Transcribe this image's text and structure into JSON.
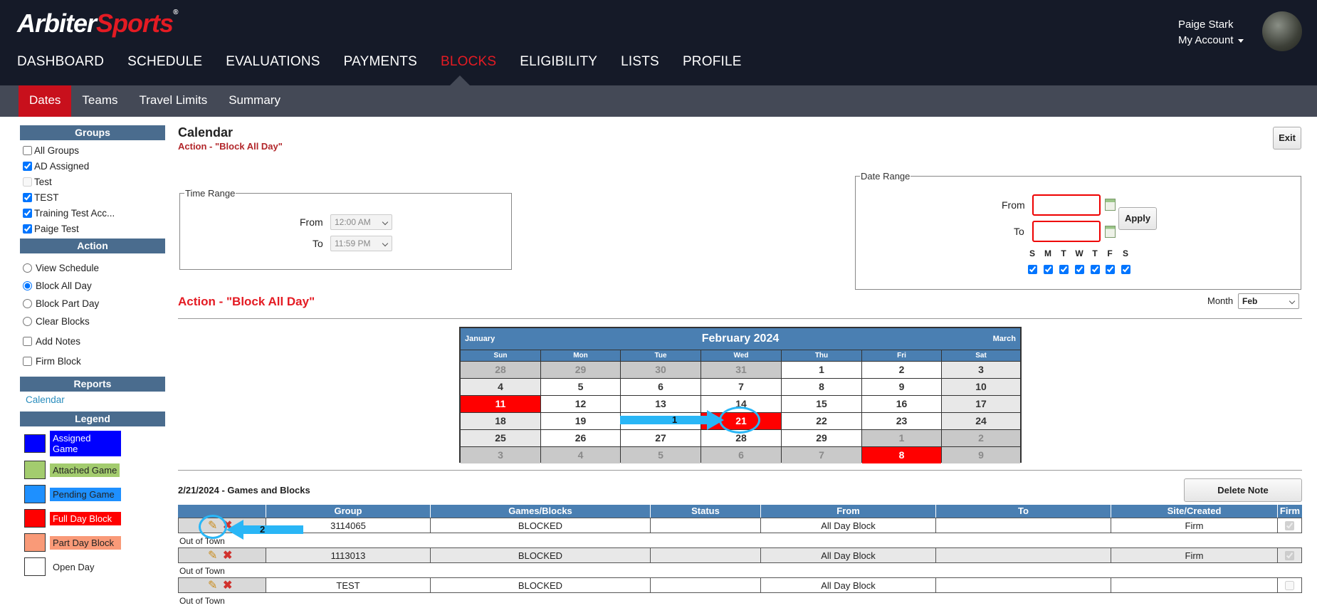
{
  "logo": {
    "part1": "Arbiter",
    "part2": "Sports",
    "reg": "®"
  },
  "main_nav": [
    {
      "label": "DASHBOARD"
    },
    {
      "label": "SCHEDULE"
    },
    {
      "label": "EVALUATIONS"
    },
    {
      "label": "PAYMENTS"
    },
    {
      "label": "BLOCKS"
    },
    {
      "label": "ELIGIBILITY"
    },
    {
      "label": "LISTS"
    },
    {
      "label": "PROFILE"
    }
  ],
  "user": {
    "name": "Paige Stark",
    "account": "My Account"
  },
  "sub_nav": [
    {
      "label": "Dates"
    },
    {
      "label": "Teams"
    },
    {
      "label": "Travel Limits"
    },
    {
      "label": "Summary"
    }
  ],
  "sidebar": {
    "groups_title": "Groups",
    "groups": [
      {
        "label": "All Groups",
        "checked": false
      },
      {
        "label": "AD Assigned",
        "checked": true
      },
      {
        "label": "Test",
        "checked": false
      },
      {
        "label": "TEST",
        "checked": true
      },
      {
        "label": "Training Test Acc...",
        "checked": true
      },
      {
        "label": "Paige Test",
        "checked": true
      }
    ],
    "action_title": "Action",
    "actions": [
      {
        "label": "View Schedule",
        "selected": false
      },
      {
        "label": "Block All Day",
        "selected": true
      },
      {
        "label": "Block Part Day",
        "selected": false
      },
      {
        "label": "Clear Blocks",
        "selected": false
      }
    ],
    "action_checks": [
      {
        "label": "Add Notes",
        "checked": false
      },
      {
        "label": "Firm Block",
        "checked": false
      }
    ],
    "reports_title": "Reports",
    "reports_link": "Calendar",
    "legend_title": "Legend",
    "legend": [
      {
        "label": "Assigned Game",
        "color": "#0000ff",
        "text_color": "#ffffff"
      },
      {
        "label": "Attached Game",
        "color": "#a3cc6e",
        "text_color": "#222222"
      },
      {
        "label": "Pending Game",
        "color": "#1e90ff",
        "text_color": "#222222"
      },
      {
        "label": "Full Day Block",
        "color": "#ff0000",
        "text_color": "#ffffff"
      },
      {
        "label": "Part Day Block",
        "color": "#f99a78",
        "text_color": "#222222"
      },
      {
        "label": "Open Day",
        "color": "#ffffff",
        "text_color": "#222222"
      }
    ]
  },
  "page": {
    "title": "Calendar",
    "subtitle": "Action - \"Block All Day\"",
    "exit_label": "Exit"
  },
  "time_range": {
    "legend": "Time Range",
    "from_label": "From",
    "from_value": "12:00 AM",
    "to_label": "To",
    "to_value": "11:59 PM"
  },
  "date_range": {
    "legend": "Date Range",
    "from_label": "From",
    "to_label": "To",
    "apply_label": "Apply",
    "days": [
      "S",
      "M",
      "T",
      "W",
      "T",
      "F",
      "S"
    ]
  },
  "action_label": "Action - \"Block All Day\"",
  "month_select": {
    "label": "Month",
    "value": "Feb"
  },
  "calendar": {
    "prev": "January",
    "title": "February 2024",
    "next": "March",
    "dow": [
      "Sun",
      "Mon",
      "Tue",
      "Wed",
      "Thu",
      "Fri",
      "Sat"
    ],
    "weeks": [
      [
        {
          "d": "28",
          "t": "o"
        },
        {
          "d": "29",
          "t": "o"
        },
        {
          "d": "30",
          "t": "o"
        },
        {
          "d": "31",
          "t": "o"
        },
        {
          "d": "1",
          "t": "w"
        },
        {
          "d": "2",
          "t": "w"
        },
        {
          "d": "3",
          "t": "e"
        }
      ],
      [
        {
          "d": "4",
          "t": "e"
        },
        {
          "d": "5",
          "t": "w"
        },
        {
          "d": "6",
          "t": "w"
        },
        {
          "d": "7",
          "t": "w"
        },
        {
          "d": "8",
          "t": "w"
        },
        {
          "d": "9",
          "t": "w"
        },
        {
          "d": "10",
          "t": "e"
        }
      ],
      [
        {
          "d": "11",
          "t": "b"
        },
        {
          "d": "12",
          "t": "w"
        },
        {
          "d": "13",
          "t": "w"
        },
        {
          "d": "14",
          "t": "w"
        },
        {
          "d": "15",
          "t": "w"
        },
        {
          "d": "16",
          "t": "w"
        },
        {
          "d": "17",
          "t": "e"
        }
      ],
      [
        {
          "d": "18",
          "t": "e"
        },
        {
          "d": "19",
          "t": "w"
        },
        {
          "d": "20",
          "t": "w"
        },
        {
          "d": "21",
          "t": "b"
        },
        {
          "d": "22",
          "t": "w"
        },
        {
          "d": "23",
          "t": "w"
        },
        {
          "d": "24",
          "t": "e"
        }
      ],
      [
        {
          "d": "25",
          "t": "e"
        },
        {
          "d": "26",
          "t": "w"
        },
        {
          "d": "27",
          "t": "w"
        },
        {
          "d": "28",
          "t": "w"
        },
        {
          "d": "29",
          "t": "w"
        },
        {
          "d": "1",
          "t": "o"
        },
        {
          "d": "2",
          "t": "o"
        }
      ],
      [
        {
          "d": "3",
          "t": "o"
        },
        {
          "d": "4",
          "t": "o"
        },
        {
          "d": "5",
          "t": "o"
        },
        {
          "d": "6",
          "t": "o"
        },
        {
          "d": "7",
          "t": "o"
        },
        {
          "d": "8",
          "t": "b"
        },
        {
          "d": "9",
          "t": "o"
        }
      ]
    ]
  },
  "games": {
    "title": "2/21/2024 - Games and Blocks",
    "delete_note_label": "Delete Note",
    "columns": [
      "Group",
      "Games/Blocks",
      "Status",
      "From",
      "To",
      "Site/Created",
      "Firm"
    ],
    "rows": [
      {
        "group": "3114065",
        "games": "BLOCKED",
        "status": "",
        "from": "All Day Block",
        "to": "",
        "site": "Firm",
        "firm": true,
        "note": "Out of Town"
      },
      {
        "group": "1113013",
        "games": "BLOCKED",
        "status": "",
        "from": "All Day Block",
        "to": "",
        "site": "Firm",
        "firm": true,
        "note": "Out of Town"
      },
      {
        "group": "TEST",
        "games": "BLOCKED",
        "status": "",
        "from": "All Day Block",
        "to": "",
        "site": "",
        "firm": false,
        "note": "Out of Town"
      }
    ]
  },
  "annotations": {
    "one": "1",
    "two": "2"
  }
}
